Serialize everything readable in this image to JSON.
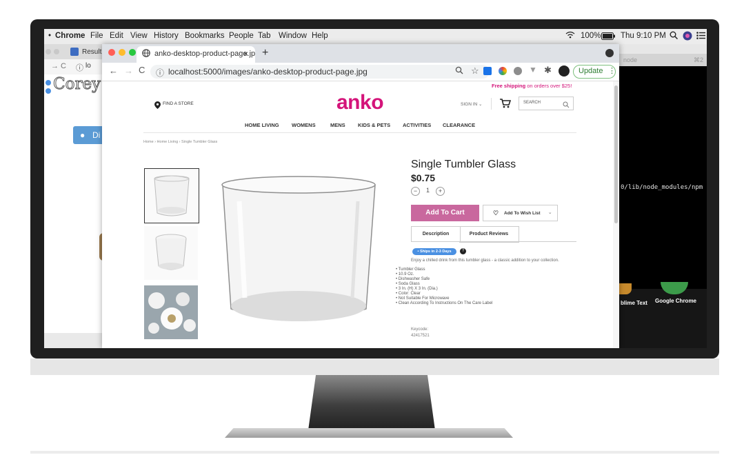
{
  "menubar": {
    "app_name": "Chrome",
    "items": [
      "File",
      "Edit",
      "View",
      "History",
      "Bookmarks",
      "People",
      "Tab",
      "Window",
      "Help"
    ],
    "battery": "100%",
    "clock": "Thu 9:10 PM"
  },
  "background_window": {
    "tab_label": "Result",
    "address_partial": "lo",
    "heading_partial": "Corey",
    "button_partial": "Di"
  },
  "terminal": {
    "title": "node",
    "shortcut": "⌘2",
    "path_line": "0/lib/node_modules/npm",
    "dock_labels": [
      "blime Text",
      "Google Chrome"
    ]
  },
  "browser": {
    "tab_title": "anko-desktop-product-page.jp",
    "url": "localhost:5000/images/anko-desktop-product-page.jpg",
    "update_label": "Update"
  },
  "site": {
    "promo_highlight": "Free shipping",
    "promo_rest": "on orders over $25!",
    "find_store": "FIND A STORE",
    "logo": "anko",
    "sign_in": "SIGN IN",
    "search_placeholder": "SEARCH",
    "nav": [
      "HOME LIVING",
      "WOMENS",
      "MENS",
      "KIDS & PETS",
      "ACTIVITIES",
      "CLEARANCE"
    ],
    "breadcrumb": "Home › Home Living › Single Tumbler Glass"
  },
  "product": {
    "title": "Single Tumbler Glass",
    "price": "$0.75",
    "qty_minus": "−",
    "qty": "1",
    "qty_plus": "+",
    "add_to_cart": "Add To Cart",
    "wishlist": "Add To Wish List",
    "tabs": [
      "Description",
      "Product Reviews"
    ],
    "ships_badge": "• Ships in 2-3 Days",
    "info_icon": "?",
    "description": "Enjoy a chilled drink from this tumbler glass - a classic addition to your collection.",
    "features": [
      "Tumbler Glass",
      "10.9 Oz.",
      "Dishwasher Safe",
      "Soda Glass",
      "3 In. (H) X 3 In. (Dia.)",
      "Color: Clear",
      "Not Suitable For Microwave",
      "Clean According To Instructions On The Care Label"
    ],
    "keycode_label": "Keycode:",
    "keycode": "42417521"
  },
  "colors": {
    "brand": "#d4147a",
    "cart_button": "#c9689e",
    "badge": "#4a90e2"
  }
}
